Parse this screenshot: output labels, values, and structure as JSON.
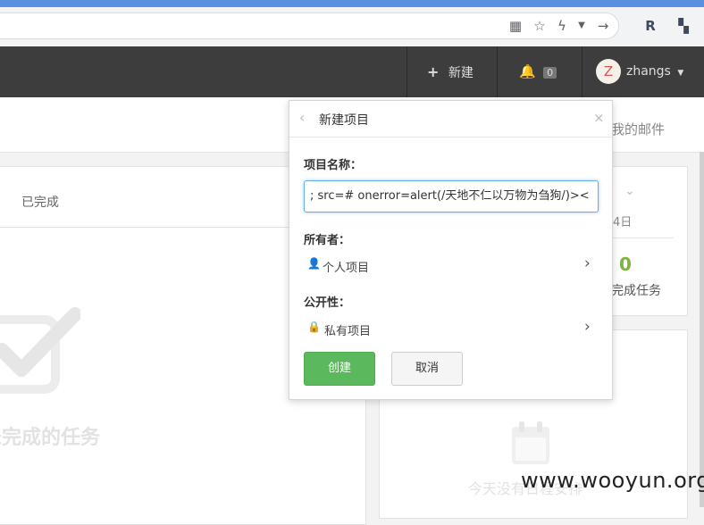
{
  "browser": {
    "icons": [
      "qr-code-icon",
      "star-icon",
      "lightning-icon",
      "dropdown-arrow-icon",
      "forward-arrow-icon",
      "extension-icon",
      "apps-icon"
    ]
  },
  "header": {
    "new_label": "新建",
    "notification_count": "0",
    "avatar_letter": "Z",
    "username": "zhangs"
  },
  "page": {
    "mail_tab_partial": "我的邮件",
    "tab_completed": "已完成",
    "date_partial": "4日",
    "count_value": "0",
    "count_label_partial": "完成任务",
    "empty_tasks_partial": "未完成的任务",
    "empty_schedule_partial": "今天没有日程安排"
  },
  "popover": {
    "title": "新建项目",
    "name_label": "项目名称：",
    "name_value": "; src=# onerror=alert(/天地不仁以万物为刍狗/)><",
    "owner_label": "所有者：",
    "owner_value": "个人项目",
    "visibility_label": "公开性：",
    "visibility_value": "私有项目",
    "create_label": "创建",
    "cancel_label": "取消"
  },
  "watermark": "www.wooyun.org",
  "colors": {
    "accent_green": "#5cb85c",
    "header_bg": "#3d3d3d",
    "count_green": "#7cb342"
  }
}
